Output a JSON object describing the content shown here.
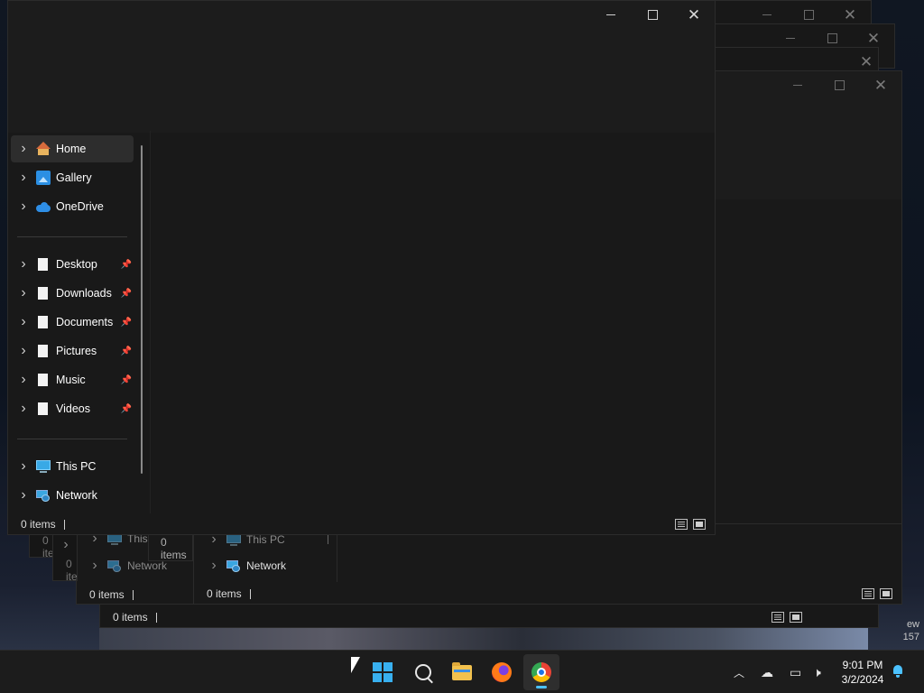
{
  "explorer": {
    "nav": {
      "quick": [
        {
          "label": "Home",
          "icon": "home-icon"
        },
        {
          "label": "Gallery",
          "icon": "gallery-icon"
        },
        {
          "label": "OneDrive",
          "icon": "onedrive-icon"
        }
      ],
      "pinned": [
        {
          "label": "Desktop",
          "icon": "file-icon"
        },
        {
          "label": "Downloads",
          "icon": "file-icon"
        },
        {
          "label": "Documents",
          "icon": "file-icon"
        },
        {
          "label": "Pictures",
          "icon": "file-icon"
        },
        {
          "label": "Music",
          "icon": "file-icon"
        },
        {
          "label": "Videos",
          "icon": "file-icon"
        }
      ],
      "locations": [
        {
          "label": "This PC",
          "icon": "this-pc-icon"
        },
        {
          "label": "Network",
          "icon": "network-icon"
        }
      ]
    },
    "status": "0 items"
  },
  "background_windows": {
    "status": "0 items",
    "this_pc": "This PC",
    "this_pc_cut": "This",
    "network": "Network"
  },
  "wallpaper": {
    "text_1": "ew",
    "text_2": "157"
  },
  "taskbar": {
    "time": "9:01 PM",
    "date": "3/2/2024"
  },
  "colors": {
    "accent": "#4cc2ff",
    "window": "#191919",
    "taskbar": "#1c1c1c"
  }
}
